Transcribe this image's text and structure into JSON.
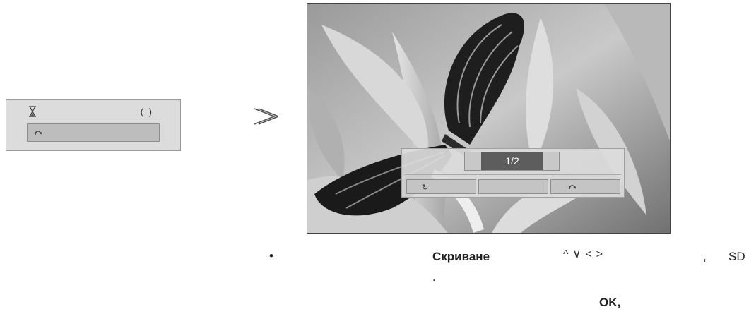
{
  "left_panel": {
    "hourglass_icon": "hourglass-icon",
    "paren_text": "( )",
    "back_icon": "back-icon"
  },
  "arrow_icon": "double-chevron-right-icon",
  "viewer": {
    "page_indicator": "1/2",
    "buttons": {
      "rotate_icon": "↻",
      "hide_label": "",
      "back_icon": "back-icon"
    }
  },
  "caption": {
    "bullet": "•",
    "hide_word": "Скриване",
    "arrow_keys": "^ v < >",
    "comma": ",",
    "sd": "SD",
    "dot": ".",
    "ok": "OK,"
  }
}
